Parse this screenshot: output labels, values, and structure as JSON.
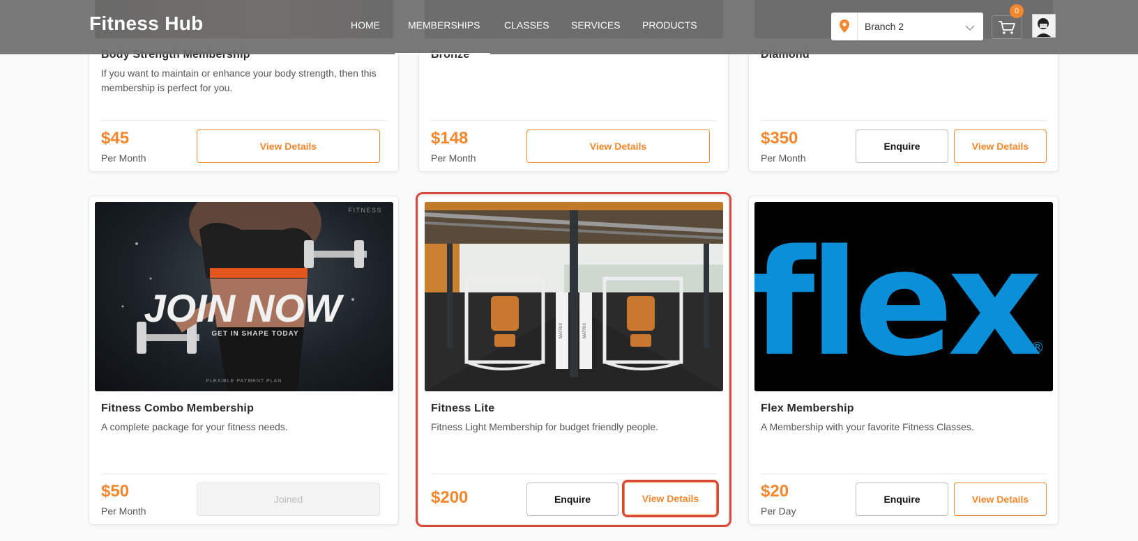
{
  "header": {
    "brand": "Fitness Hub",
    "nav": [
      "HOME",
      "MEMBERSHIPS",
      "CLASSES",
      "SERVICES",
      "PRODUCTS"
    ],
    "active_nav": "MEMBERSHIPS",
    "branch_select": {
      "value": "Branch 2",
      "icon": "map-pin-icon"
    },
    "cart": {
      "icon": "cart-icon",
      "count": "0"
    },
    "avatar_icon": "user-avatar"
  },
  "colors": {
    "accent": "#f5872e",
    "highlight": "#d9483b",
    "flex_blue": "#0b8fd9"
  },
  "row1": [
    {
      "title": "Body Strength Membership",
      "description": "If you want to maintain or enhance your body strength, then this membership is perfect for you.",
      "price": "$45",
      "period": "Per Month",
      "view_label": "View Details"
    },
    {
      "title": "Bronze",
      "description": "",
      "price": "$148",
      "period": "Per Month",
      "view_label": "View Details"
    },
    {
      "title": "Diamond",
      "description": "",
      "price": "$350",
      "period": "Per Month",
      "enquire_label": "Enquire",
      "view_label": "View Details"
    }
  ],
  "row2": [
    {
      "title": "Fitness Combo Membership",
      "description": "A complete package for your fitness needs.",
      "price": "$50",
      "period": "Per Month",
      "joined_label": "Joined",
      "image": {
        "corner_text": "FITNESS",
        "headline": "JOIN NOW",
        "tagline": "GET IN SHAPE TODAY",
        "footer": "FLEXIBLE PAYMENT PLAN"
      }
    },
    {
      "title": "Fitness Lite",
      "description": "Fitness Light Membership for budget friendly people.",
      "price": "$200",
      "period": "",
      "enquire_label": "Enquire",
      "view_label": "View Details",
      "image": {
        "machine_brand": "MATRIX"
      }
    },
    {
      "title": "Flex Membership",
      "description": "A Membership with your favorite Fitness Classes.",
      "price": "$20",
      "period": "Per Day",
      "enquire_label": "Enquire",
      "view_label": "View Details",
      "image": {
        "logo_text": "flex",
        "registered": "®"
      }
    }
  ]
}
